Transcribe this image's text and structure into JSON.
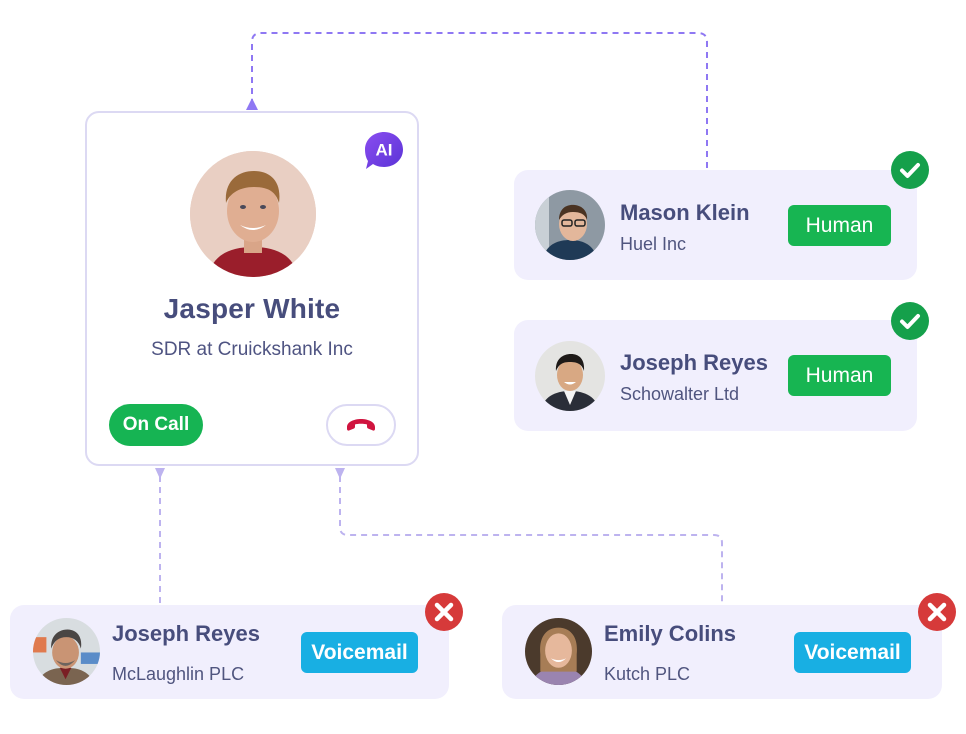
{
  "colors": {
    "connector_active": "#8f78f3",
    "connector_inactive": "#bdb3ef",
    "card_border": "#dcd9f3",
    "card_bg": "#f1effd",
    "ai_badge": "#6a3ee0",
    "on_call_green": "#16b453",
    "human_green": "#17b552",
    "voicemail_blue": "#18afe3",
    "check_green": "#15a04b",
    "error_red": "#d63a3a",
    "hangup_red": "#d0143f",
    "text_primary": "#474d7c"
  },
  "main_card": {
    "badge_label": "AI",
    "name": "Jasper White",
    "title": "SDR at Cruickshank Inc",
    "status_label": "On Call",
    "hangup_icon": "phone-hangup-icon"
  },
  "contacts": [
    {
      "name": "Mason Klein",
      "company": "Huel Inc",
      "tag": "Human",
      "status": "success",
      "status_icon": "check-circle-icon"
    },
    {
      "name": "Joseph Reyes",
      "company": "Schowalter Ltd",
      "tag": "Human",
      "status": "success",
      "status_icon": "check-circle-icon"
    },
    {
      "name": "Joseph Reyes",
      "company": "McLaughlin PLC",
      "tag": "Voicemail",
      "status": "failed",
      "status_icon": "x-circle-icon"
    },
    {
      "name": "Emily Colins",
      "company": "Kutch PLC",
      "tag": "Voicemail",
      "status": "failed",
      "status_icon": "x-circle-icon"
    }
  ]
}
